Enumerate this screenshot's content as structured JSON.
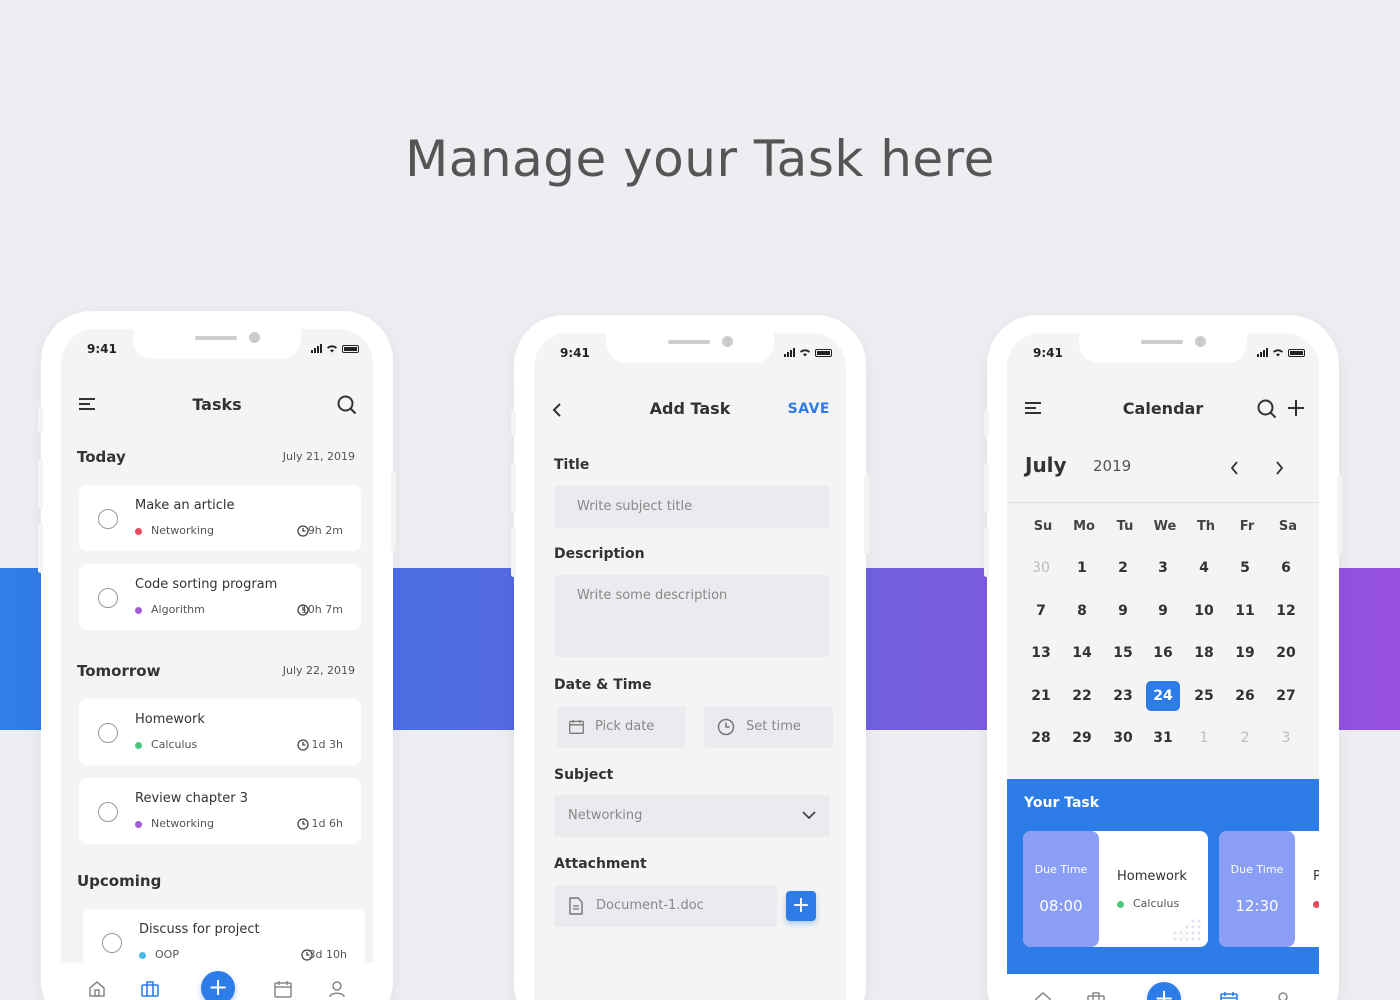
{
  "headline": "Manage your Task here",
  "colors": {
    "accent": "#2d7ce8",
    "networking": "#e84a5f",
    "algorithm": "#a35bd8",
    "calculus": "#4cc782",
    "oop": "#4ab8e8"
  },
  "status_time": "9:41",
  "tasks_screen": {
    "title": "Tasks",
    "groups": [
      {
        "label": "Today",
        "date": "July 21, 2019",
        "items": [
          {
            "title": "Make an article",
            "subject": "Networking",
            "duration": "9h 2m"
          },
          {
            "title": "Code sorting program",
            "subject": "Algorithm",
            "duration": "10h 7m"
          }
        ]
      },
      {
        "label": "Tomorrow",
        "date": "July 22, 2019",
        "items": [
          {
            "title": "Homework",
            "subject": "Calculus",
            "duration": "1d  3h"
          },
          {
            "title": "Review chapter 3",
            "subject": "Networking",
            "duration": "1d 6h"
          }
        ]
      },
      {
        "label": "Upcoming",
        "date": "",
        "items": [
          {
            "title": "Discuss for project",
            "subject": "OOP",
            "duration": "3d 10h"
          }
        ]
      }
    ]
  },
  "add_task_screen": {
    "title": "Add Task",
    "save_label": "SAVE",
    "title_label": "Title",
    "title_placeholder": "Write subject title",
    "description_label": "Description",
    "description_placeholder": "Write some description",
    "datetime_label": "Date & Time",
    "date_placeholder": "Pick date",
    "time_placeholder": "Set time",
    "subject_label": "Subject",
    "subject_value": "Networking",
    "attachment_label": "Attachment",
    "attachment_file": "Document-1.doc"
  },
  "calendar_screen": {
    "title": "Calendar",
    "month": "July",
    "year": "2019",
    "weekdays": [
      "Su",
      "Mo",
      "Tu",
      "We",
      "Th",
      "Fr",
      "Sa"
    ],
    "weeks": [
      [
        "30",
        "1",
        "2",
        "3",
        "4",
        "5",
        "6"
      ],
      [
        "7",
        "8",
        "9",
        "9",
        "10",
        "11",
        "12"
      ],
      [
        "13",
        "14",
        "15",
        "16",
        "18",
        "19",
        "20"
      ],
      [
        "21",
        "22",
        "23",
        "24",
        "25",
        "26",
        "27"
      ],
      [
        "28",
        "29",
        "30",
        "31",
        "1",
        "2",
        "3"
      ]
    ],
    "selected_day": "24",
    "your_task_label": "Your Task",
    "task_cards": [
      {
        "due_label": "Due Time",
        "due_time": "08:00",
        "title": "Homework",
        "subject": "Calculus"
      },
      {
        "due_label": "Due Time",
        "due_time": "12:30",
        "title": "P",
        "subject": ""
      }
    ]
  }
}
